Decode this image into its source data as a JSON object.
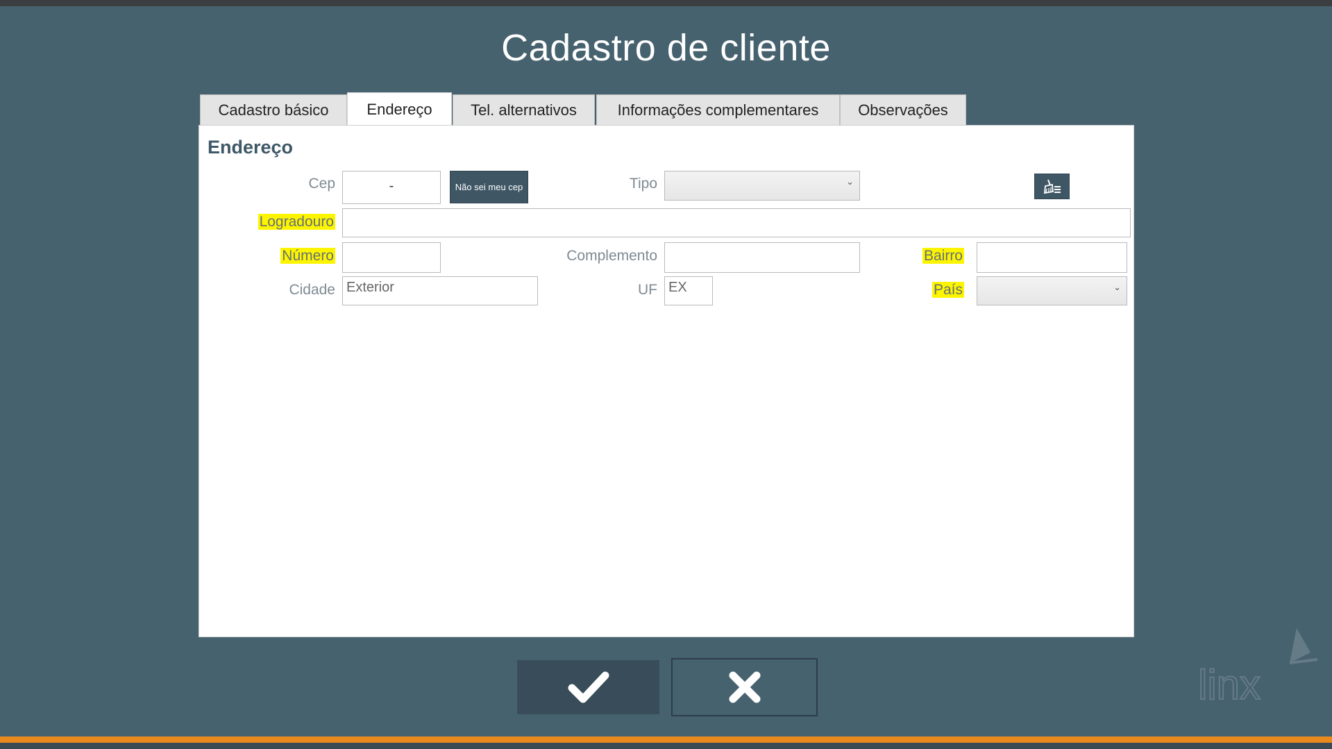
{
  "title": "Cadastro de cliente",
  "tabs": [
    {
      "label": "Cadastro básico",
      "active": false
    },
    {
      "label": "Endereço",
      "active": true
    },
    {
      "label": "Tel. alternativos",
      "active": false
    },
    {
      "label": "Informações complementares",
      "active": false
    },
    {
      "label": "Observações",
      "active": false
    }
  ],
  "section": {
    "title": "Endereço"
  },
  "form": {
    "cep": {
      "label": "Cep",
      "value": "-"
    },
    "cep_button": "Não sei meu cep",
    "tipo": {
      "label": "Tipo",
      "value": ""
    },
    "logradouro": {
      "label": "Logradouro",
      "value": "",
      "required": true
    },
    "numero": {
      "label": "Número",
      "value": "",
      "required": true
    },
    "complemento": {
      "label": "Complemento",
      "value": ""
    },
    "bairro": {
      "label": "Bairro",
      "value": "",
      "required": true
    },
    "cidade": {
      "label": "Cidade",
      "value": "Exterior"
    },
    "uf": {
      "label": "UF",
      "value": "EX"
    },
    "pais": {
      "label": "País",
      "value": "",
      "required": true
    }
  },
  "icons": {
    "clear": "broom-list-icon",
    "confirm": "check-icon",
    "cancel": "close-icon",
    "logo": "linx-logo"
  },
  "colors": {
    "background": "#47626f",
    "accent_bar": "#ea8a1e",
    "button": "#3f5665",
    "required_highlight": "#fdf500"
  }
}
